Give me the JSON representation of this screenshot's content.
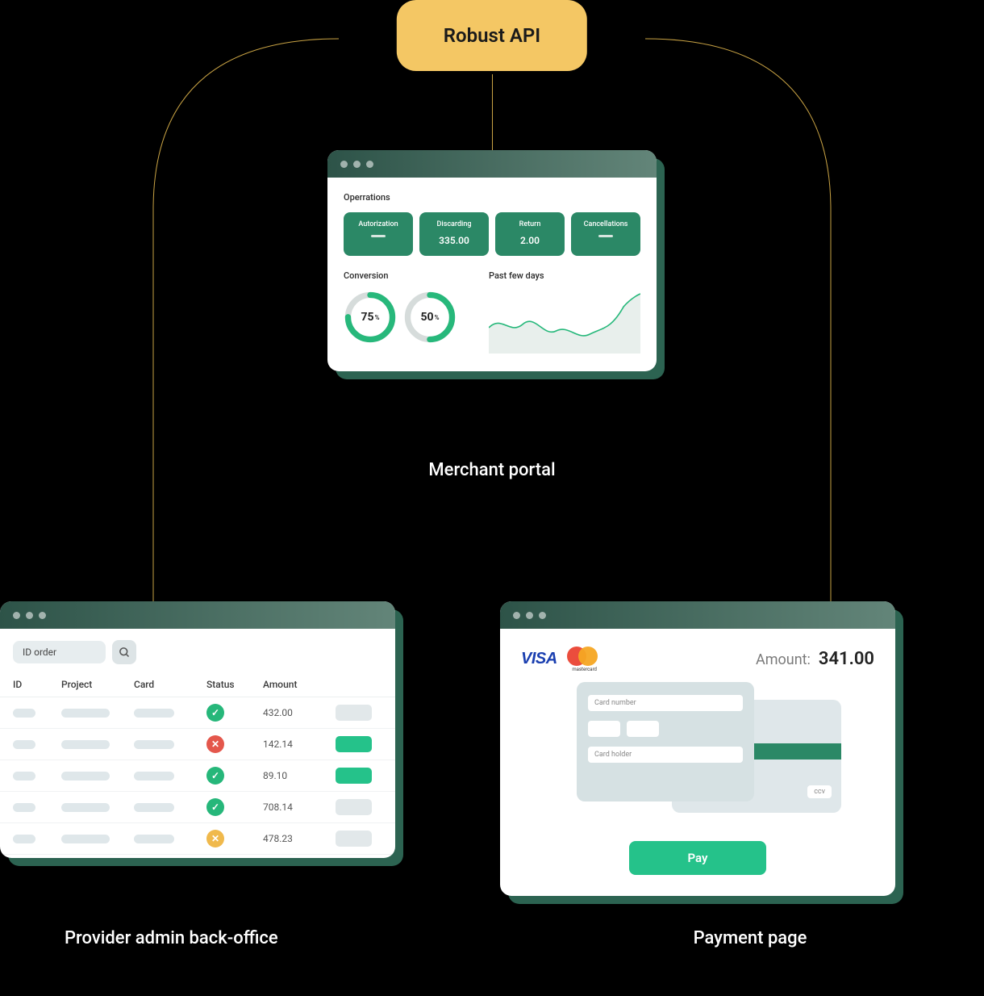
{
  "api_pill": {
    "label": "Robust API"
  },
  "merchant_portal": {
    "caption": "Merchant portal",
    "operations_title": "Operrations",
    "ops": [
      {
        "label": "Autorization",
        "value": null
      },
      {
        "label": "Discarding",
        "value": "335.00"
      },
      {
        "label": "Return",
        "value": "2.00"
      },
      {
        "label": "Cancellations",
        "value": null
      }
    ],
    "conversion_title": "Conversion",
    "donuts": [
      {
        "pct": 75,
        "text": "75"
      },
      {
        "pct": 50,
        "text": "50"
      }
    ],
    "chart_title": "Past few days"
  },
  "back_office": {
    "caption": "Provider admin back-office",
    "search_placeholder": "ID order",
    "columns": [
      "ID",
      "Project",
      "Card",
      "Status",
      "Amount"
    ],
    "rows": [
      {
        "status": "ok",
        "amount": "432.00",
        "action": false
      },
      {
        "status": "err",
        "amount": "142.14",
        "action": true
      },
      {
        "status": "ok",
        "amount": "89.10",
        "action": true
      },
      {
        "status": "ok",
        "amount": "708.14",
        "action": false
      },
      {
        "status": "warn",
        "amount": "478.23",
        "action": false
      }
    ]
  },
  "payment_page": {
    "caption": "Payment page",
    "visa_label": "VISA",
    "mastercard_label": "mastercard",
    "amount_label": "Amount:",
    "amount_value": "341.00",
    "card_number_placeholder": "Card number",
    "card_holder_placeholder": "Card holder",
    "ccv_placeholder": "ccv",
    "pay_button": "Pay"
  },
  "chart_data": {
    "type": "line",
    "title": "Past few days",
    "x": [
      0,
      1,
      2,
      3,
      4,
      5,
      6,
      7,
      8,
      9
    ],
    "values": [
      40,
      55,
      35,
      48,
      30,
      38,
      28,
      34,
      60,
      80
    ],
    "ylim": [
      0,
      100
    ]
  }
}
